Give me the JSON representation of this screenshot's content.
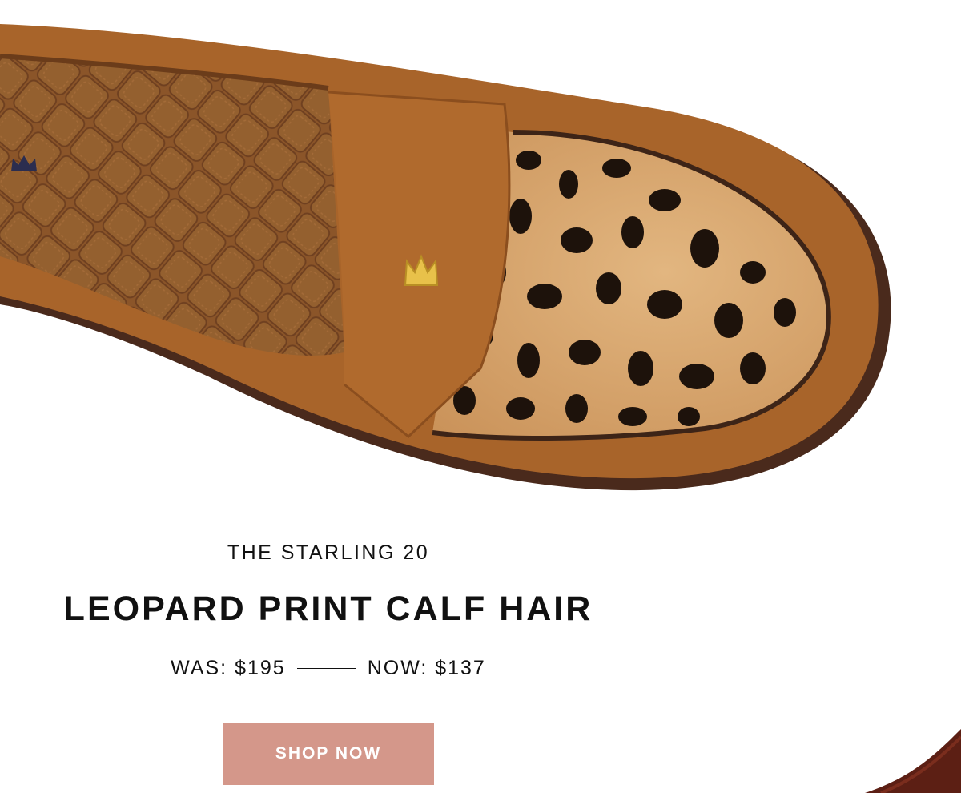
{
  "product": {
    "subtitle": "THE STARLING 20",
    "title": "LEOPARD PRINT CALF HAIR",
    "was_price": "WAS: $195",
    "now_price": "NOW: $137"
  },
  "cta": {
    "label": "SHOP NOW"
  },
  "colors": {
    "suede": "#a8642a",
    "insole": "#8a5426",
    "sole": "#4a2a1c",
    "cta_bg": "#d4978a",
    "text": "#111111",
    "charm": "#e8c14a"
  },
  "images": {
    "hero": "leopard-loafer-top-view",
    "corner": "second-shoe-partial"
  }
}
